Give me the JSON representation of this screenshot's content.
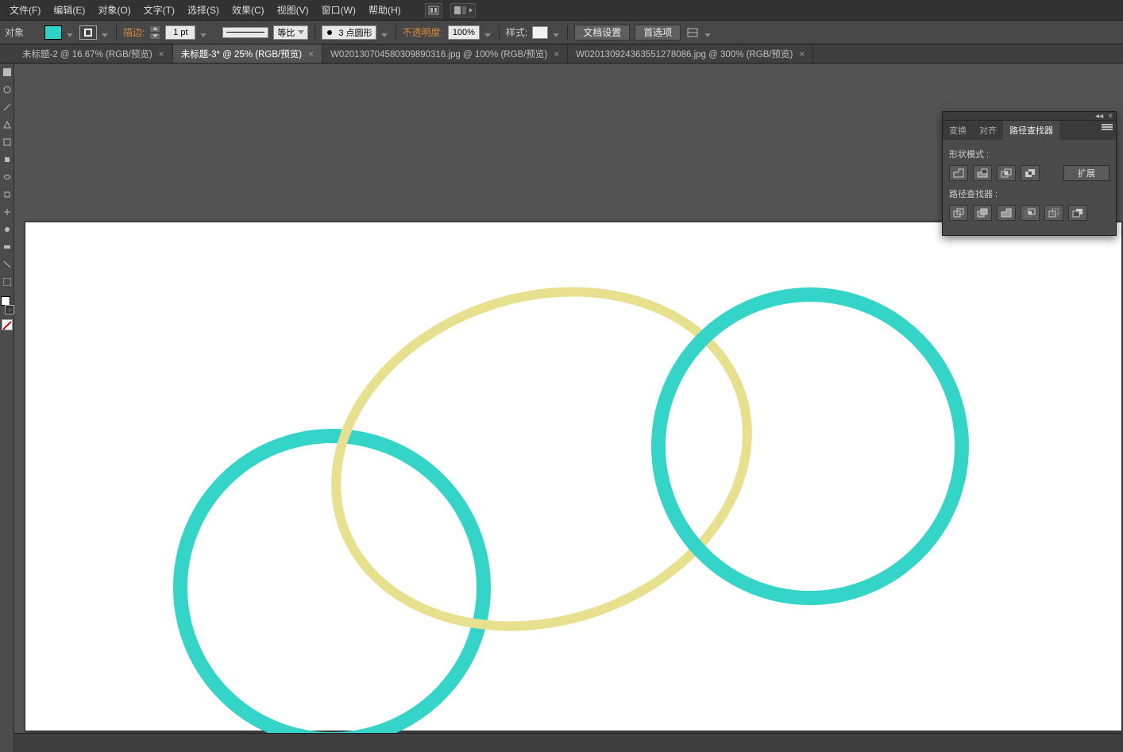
{
  "menu": {
    "file": "文件(F)",
    "edit": "编辑(E)",
    "object": "对象(O)",
    "type": "文字(T)",
    "select": "选择(S)",
    "effect": "效果(C)",
    "view": "视图(V)",
    "window": "窗口(W)",
    "help": "帮助(H)"
  },
  "ctrl": {
    "target_label": "对象",
    "stroke_label": "描边:",
    "stroke_weight": "1 pt",
    "dash_label": "等比",
    "brush_label": "3 点圆形",
    "opacity_label": "不透明度:",
    "opacity_value": "100%",
    "style_label": "样式:",
    "doc_setup": "文档设置",
    "prefs": "首选项"
  },
  "tabs": [
    {
      "label": "未标题-2 @ 16.67% (RGB/预览)",
      "active": false
    },
    {
      "label": "未标题-3* @ 25% (RGB/预览)",
      "active": true
    },
    {
      "label": "W020130704580309890316.jpg @ 100% (RGB/预览)",
      "active": false
    },
    {
      "label": "W020130924363551278086.jpg @ 300% (RGB/预览)",
      "active": false
    }
  ],
  "panel": {
    "tab_transform": "变换",
    "tab_align": "对齐",
    "tab_pathfinder": "路径查找器",
    "shape_modes": "形状模式 :",
    "pathfinders": "路径查找器 :",
    "expand": "扩展"
  }
}
